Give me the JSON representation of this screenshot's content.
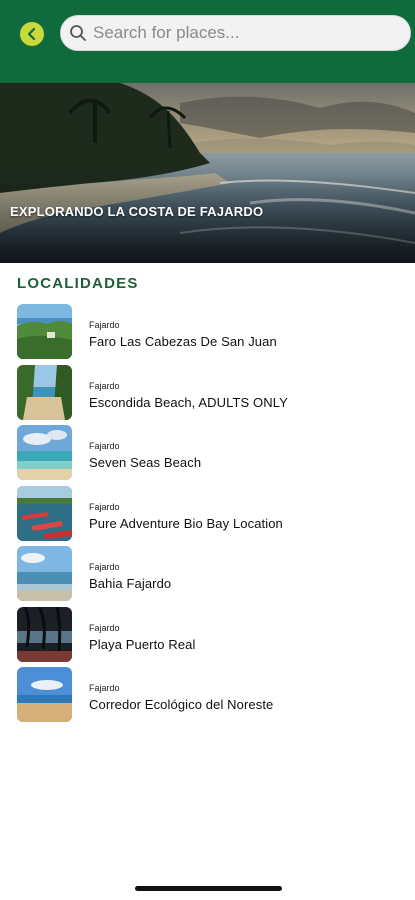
{
  "colors": {
    "header": "#0f6b3c",
    "back_button": "#c9d83a",
    "section_title": "#1f5f3a"
  },
  "header": {
    "back_icon": "chevron-left-icon",
    "search_icon": "search-icon",
    "search_placeholder": "Search for places..."
  },
  "hero": {
    "title": "EXPLORANDO LA COSTA DE FAJARDO"
  },
  "section": {
    "title": "LOCALIDADES"
  },
  "places": [
    {
      "city": "Fajardo",
      "name": "Faro Las Cabezas De San Juan"
    },
    {
      "city": "Fajardo",
      "name": "Escondida Beach, ADULTS ONLY"
    },
    {
      "city": "Fajardo",
      "name": "Seven Seas Beach"
    },
    {
      "city": "Fajardo",
      "name": "Pure Adventure Bio Bay Location"
    },
    {
      "city": "Fajardo",
      "name": "Bahia Fajardo"
    },
    {
      "city": "Fajardo",
      "name": "Playa Puerto Real"
    },
    {
      "city": "Fajardo",
      "name": "Corredor Ecológico del Noreste"
    }
  ]
}
